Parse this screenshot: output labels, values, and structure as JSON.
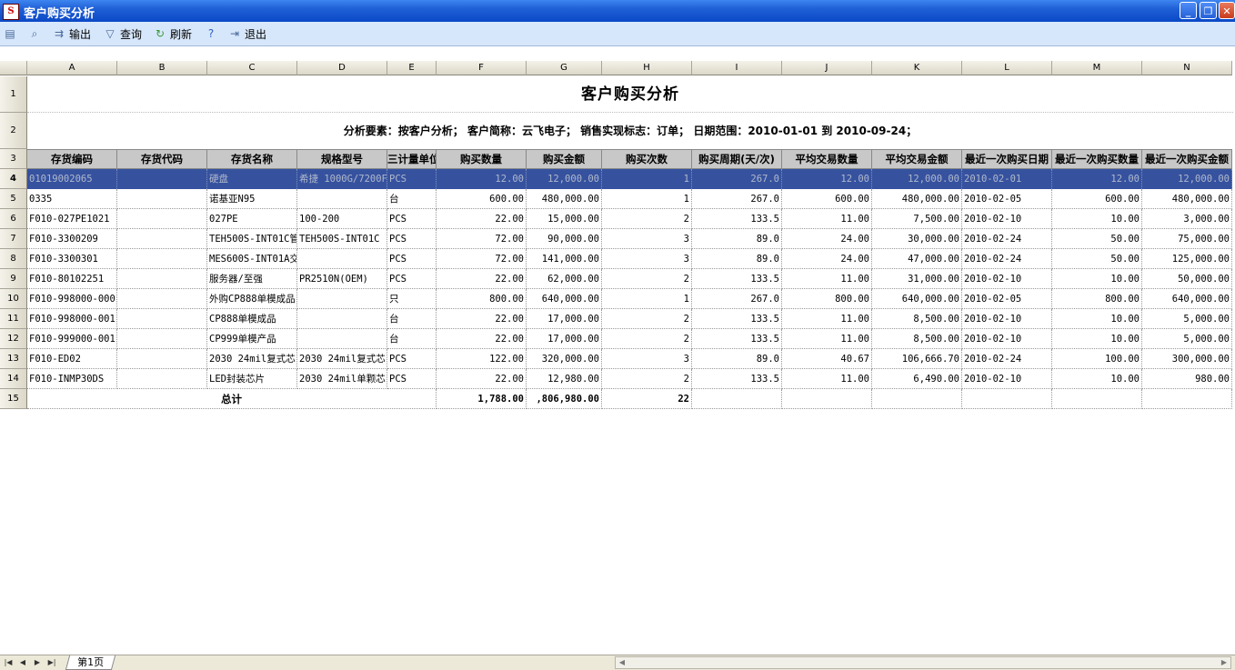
{
  "window": {
    "title": "客户购买分析",
    "icon": "app-logo"
  },
  "toolbar": {
    "print_icon": "printer-icon",
    "preview_icon": "print-preview-icon",
    "export_label": "输出",
    "query_label": "查询",
    "refresh_label": "刷新",
    "help_icon": "help-icon",
    "exit_label": "退出"
  },
  "columns": [
    "A",
    "B",
    "C",
    "D",
    "E",
    "F",
    "G",
    "H",
    "I",
    "J",
    "K",
    "L",
    "M",
    "N"
  ],
  "row_numbers": [
    "1",
    "2",
    "3",
    "4",
    "5",
    "6",
    "7",
    "8",
    "9",
    "10",
    "11",
    "12",
    "13",
    "14",
    "15"
  ],
  "report": {
    "title": "客户购买分析",
    "criteria": "分析要素：按客户分析； 客户简称：云飞电子； 销售实现标志：订单； 日期范围：2010-01-01 到 2010-09-24；"
  },
  "headers": [
    "存货编码",
    "存货代码",
    "存货名称",
    "规格型号",
    "计量单位",
    "购买数量",
    "购买金额",
    "购买次数",
    "购买周期(天/次)",
    "平均交易数量",
    "平均交易金额",
    "最近一次购买日期",
    "最近一次购买数量",
    "最近一次购买金额"
  ],
  "headers_visible": [
    "存货编码",
    "存货代码",
    "存货名称",
    "规格型号",
    "三计量单位",
    "购买数量",
    "购买金额",
    "购买次数",
    "购买周期(天/次)",
    "平均交易数量",
    "平均交易金额",
    "最近一次购买日期",
    "最近一次购买数量",
    "最近一次购买金额"
  ],
  "rows": [
    [
      "01019002065",
      "",
      "硬盘",
      "希捷 1000G/7200F",
      "PCS",
      "12.00",
      "12,000.00",
      "1",
      "267.0",
      "12.00",
      "12,000.00",
      "2010-02-01",
      "12.00",
      "12,000.00"
    ],
    [
      "0335",
      "",
      "诺基亚N95",
      "",
      "台",
      "600.00",
      "480,000.00",
      "1",
      "267.0",
      "600.00",
      "480,000.00",
      "2010-02-05",
      "600.00",
      "480,000.00"
    ],
    [
      "F010-027PE1021",
      "",
      "027PE",
      "100-200",
      "PCS",
      "22.00",
      "15,000.00",
      "2",
      "133.5",
      "11.00",
      "7,500.00",
      "2010-02-10",
      "10.00",
      "3,000.00"
    ],
    [
      "F010-3300209",
      "",
      "TEH500S-INT01C管",
      "TEH500S-INT01C",
      "PCS",
      "72.00",
      "90,000.00",
      "3",
      "89.0",
      "24.00",
      "30,000.00",
      "2010-02-24",
      "50.00",
      "75,000.00"
    ],
    [
      "F010-3300301",
      "",
      "MES600S-INT01A交",
      "",
      "PCS",
      "72.00",
      "141,000.00",
      "3",
      "89.0",
      "24.00",
      "47,000.00",
      "2010-02-24",
      "50.00",
      "125,000.00"
    ],
    [
      "F010-80102251",
      "",
      "服务器/至强",
      "PR2510N(OEM)",
      "PCS",
      "22.00",
      "62,000.00",
      "2",
      "133.5",
      "11.00",
      "31,000.00",
      "2010-02-10",
      "10.00",
      "50,000.00"
    ],
    [
      "F010-998000-000",
      "",
      "外购CP888单模成品",
      "",
      "只",
      "800.00",
      "640,000.00",
      "1",
      "267.0",
      "800.00",
      "640,000.00",
      "2010-02-05",
      "800.00",
      "640,000.00"
    ],
    [
      "F010-998000-001",
      "",
      "CP888单模成品",
      "",
      "台",
      "22.00",
      "17,000.00",
      "2",
      "133.5",
      "11.00",
      "8,500.00",
      "2010-02-10",
      "10.00",
      "5,000.00"
    ],
    [
      "F010-999000-001",
      "",
      "CP999单模产品",
      "",
      "台",
      "22.00",
      "17,000.00",
      "2",
      "133.5",
      "11.00",
      "8,500.00",
      "2010-02-10",
      "10.00",
      "5,000.00"
    ],
    [
      "F010-ED02",
      "",
      "2030 24mil复式芯",
      "2030 24mil复式芯",
      "PCS",
      "122.00",
      "320,000.00",
      "3",
      "89.0",
      "40.67",
      "106,666.70",
      "2010-02-24",
      "100.00",
      "300,000.00"
    ],
    [
      "F010-INMP30DS",
      "",
      "LED封装芯片",
      "2030 24mil单颗芯",
      "PCS",
      "22.00",
      "12,980.00",
      "2",
      "133.5",
      "11.00",
      "6,490.00",
      "2010-02-10",
      "10.00",
      "980.00"
    ]
  ],
  "total": {
    "label": "总计",
    "qty": "1,788.00",
    "amount": ",806,980.00",
    "count": "22"
  },
  "sheet_tab": "第1页"
}
